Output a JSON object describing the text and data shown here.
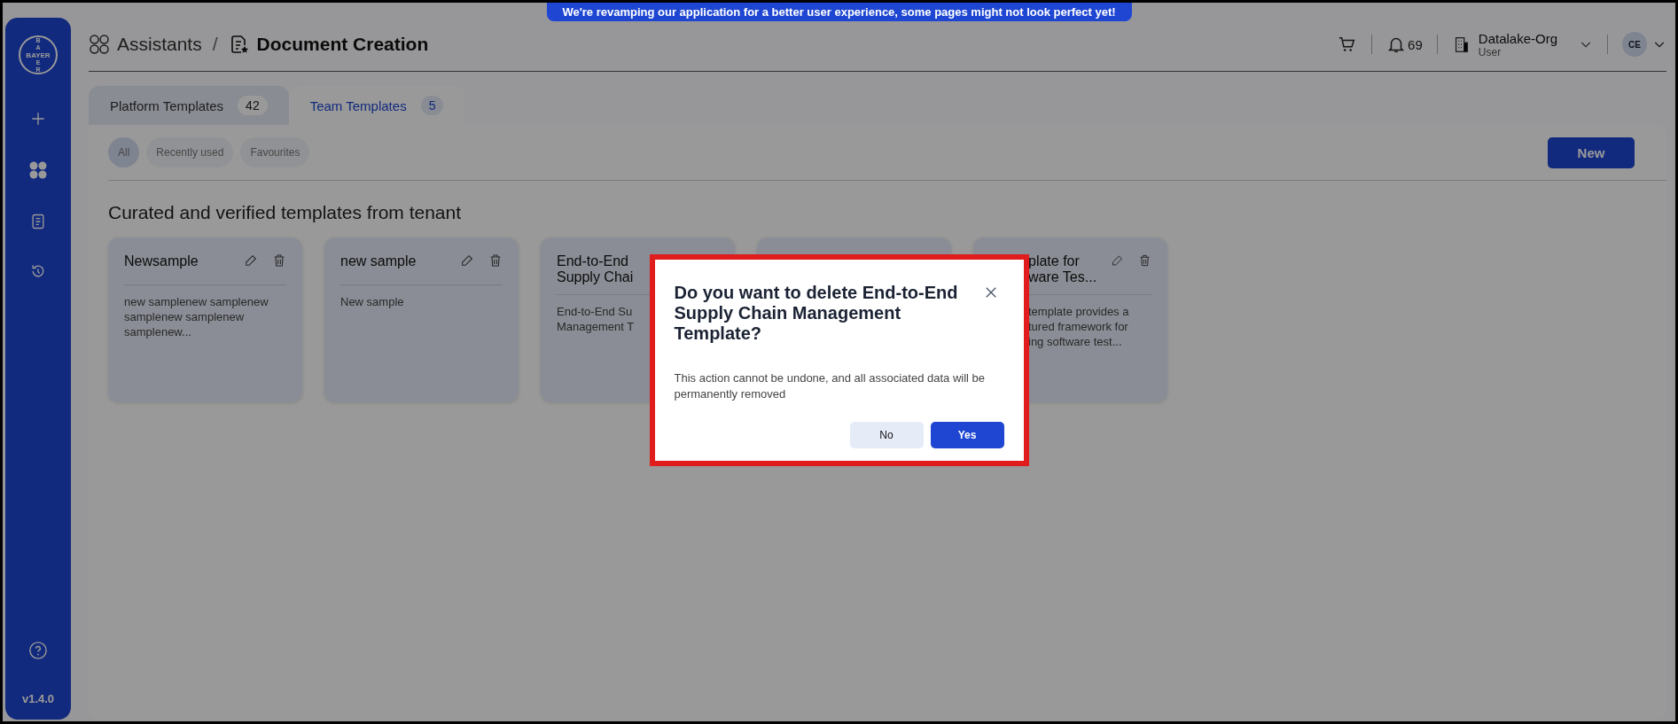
{
  "banner": {
    "text": "We're revamping our application for a better user experience, some pages might not look perfect yet!"
  },
  "sidebar": {
    "logo": {
      "top": "BA",
      "middle": "BAYER",
      "bottom": "ER"
    },
    "version": "v1.4.0"
  },
  "breadcrumb": [
    {
      "label": "Assistants",
      "current": false
    },
    {
      "separator": "/",
      "label": "Document Creation",
      "current": true
    }
  ],
  "header": {
    "notifications": "69",
    "org": "Datalake-Org",
    "role": "User",
    "avatar": "CE"
  },
  "tabs": [
    {
      "label": "Platform Templates",
      "count": "42",
      "selected": false
    },
    {
      "label": "Team Templates",
      "count": "5",
      "selected": true
    }
  ],
  "filters": [
    {
      "label": "All",
      "selected": true
    },
    {
      "label": "Recently used",
      "selected": false
    },
    {
      "label": "Favourites",
      "selected": false
    }
  ],
  "new_button": "New",
  "heading": "Curated and verified templates from tenant",
  "cards": [
    {
      "kind": "whole",
      "title": "Newsample",
      "description": "new samplenew samplenew samplenew samplenew samplenew...",
      "actions": true
    },
    {
      "kind": "whole",
      "title": "new sample",
      "description": "New sample",
      "actions": true
    },
    {
      "kind": "cut-right",
      "title": "End-to-End\nSupply Chai",
      "description": "End-to-End Su\nManagement T"
    },
    {
      "kind": "hidden"
    },
    {
      "kind": "cut-left",
      "title": "plate for\nware Tes...",
      "description": "template provides a\ntured framework for\ning software test...",
      "actions": true
    }
  ],
  "dialog": {
    "title": "Do you want to delete End-to-End Supply Chain Management Template?",
    "message": "This action cannot be undone, and all associated data will be permanently removed",
    "buttons": [
      {
        "label": "No",
        "kind": "secondary"
      },
      {
        "label": "Yes",
        "kind": "primary"
      }
    ]
  }
}
